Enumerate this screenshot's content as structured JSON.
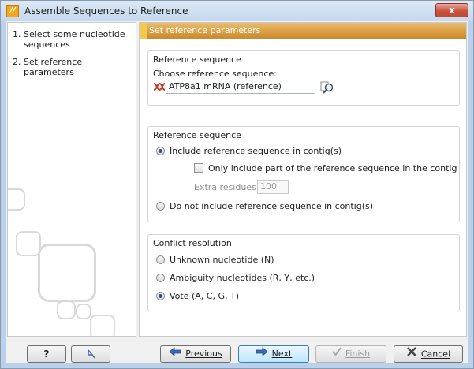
{
  "window": {
    "title": "Assemble Sequences to Reference",
    "app_icon": "clc-icon",
    "close_label": "x"
  },
  "steps": [
    {
      "num": "1.",
      "label": "Select some nucleotide sequences"
    },
    {
      "num": "2.",
      "label": "Set reference parameters"
    }
  ],
  "header": {
    "title": "Set reference parameters"
  },
  "reference_group": {
    "title": "Reference sequence",
    "choose_label": "Choose reference sequence:",
    "value": "ATP8a1 mRNA (reference)",
    "dna_icon": "dna-icon",
    "browse_icon": "browse-icon"
  },
  "include_group": {
    "title": "Reference sequence",
    "include_label": "Include reference sequence in contig(s)",
    "include_checked": true,
    "only_part_label": "Only include part of the reference sequence in the contig",
    "only_part_checked": false,
    "extra_label": "Extra residues:",
    "extra_value": "100",
    "exclude_label": "Do not include reference sequence in contig(s)",
    "exclude_checked": false
  },
  "conflict_group": {
    "title": "Conflict resolution",
    "options": [
      {
        "label": "Unknown nucleotide (N)",
        "checked": false
      },
      {
        "label": "Ambiguity nucleotides (R, Y, etc.)",
        "checked": false
      },
      {
        "label": "Vote (A, C, G, T)",
        "checked": true
      }
    ]
  },
  "buttons": {
    "help": "?",
    "reset_icon": "reset-icon",
    "previous": "Previous",
    "next": "Next",
    "finish": "Finish",
    "cancel": "Cancel"
  },
  "colors": {
    "header_accent": "#dfa34a",
    "window_frame": "#b9d1ea",
    "close_red": "#c7513b"
  }
}
